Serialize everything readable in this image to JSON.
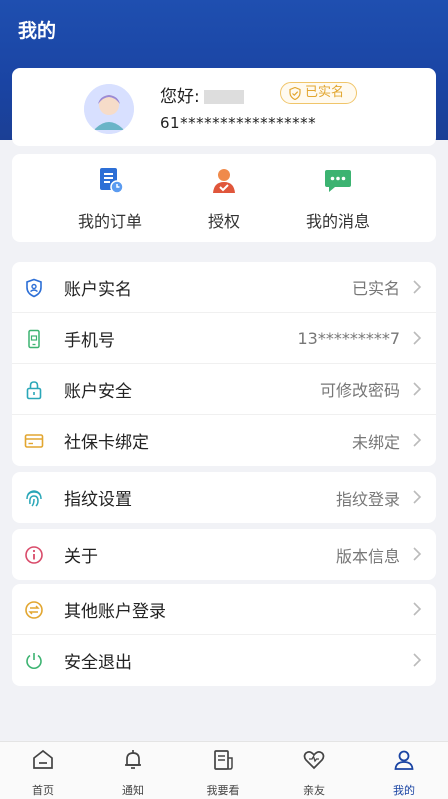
{
  "header": {
    "title": "我的"
  },
  "profile": {
    "greeting": "您好:",
    "verified_badge": "已实名",
    "phone_masked": "61*****************"
  },
  "quick_actions": [
    {
      "label": "我的订单",
      "icon": "order-icon"
    },
    {
      "label": "授权",
      "icon": "authorize-icon"
    },
    {
      "label": "我的消息",
      "icon": "message-icon"
    }
  ],
  "settings": {
    "group1": [
      {
        "label": "账户实名",
        "value": "已实名",
        "icon": "id-shield-icon"
      },
      {
        "label": "手机号",
        "value": "13*********7",
        "icon": "phone-icon"
      },
      {
        "label": "账户安全",
        "value": "可修改密码",
        "icon": "lock-icon"
      },
      {
        "label": "社保卡绑定",
        "value": "未绑定",
        "icon": "card-icon"
      }
    ],
    "group2": [
      {
        "label": "指纹设置",
        "value": "指纹登录",
        "icon": "fingerprint-icon"
      }
    ],
    "group3": [
      {
        "label": "关于",
        "value": "版本信息",
        "icon": "info-icon"
      }
    ],
    "group4": [
      {
        "label": "其他账户登录",
        "value": "",
        "icon": "switch-account-icon"
      },
      {
        "label": "安全退出",
        "value": "",
        "icon": "power-icon"
      }
    ]
  },
  "tabbar": [
    {
      "label": "首页",
      "icon": "home-icon"
    },
    {
      "label": "通知",
      "icon": "bell-icon"
    },
    {
      "label": "我要看",
      "icon": "document-icon"
    },
    {
      "label": "亲友",
      "icon": "heart-icon"
    },
    {
      "label": "我的",
      "icon": "user-icon",
      "active": true
    }
  ],
  "colors": {
    "header_blue": "#1a44a3",
    "accent_gold": "#e2a630"
  }
}
